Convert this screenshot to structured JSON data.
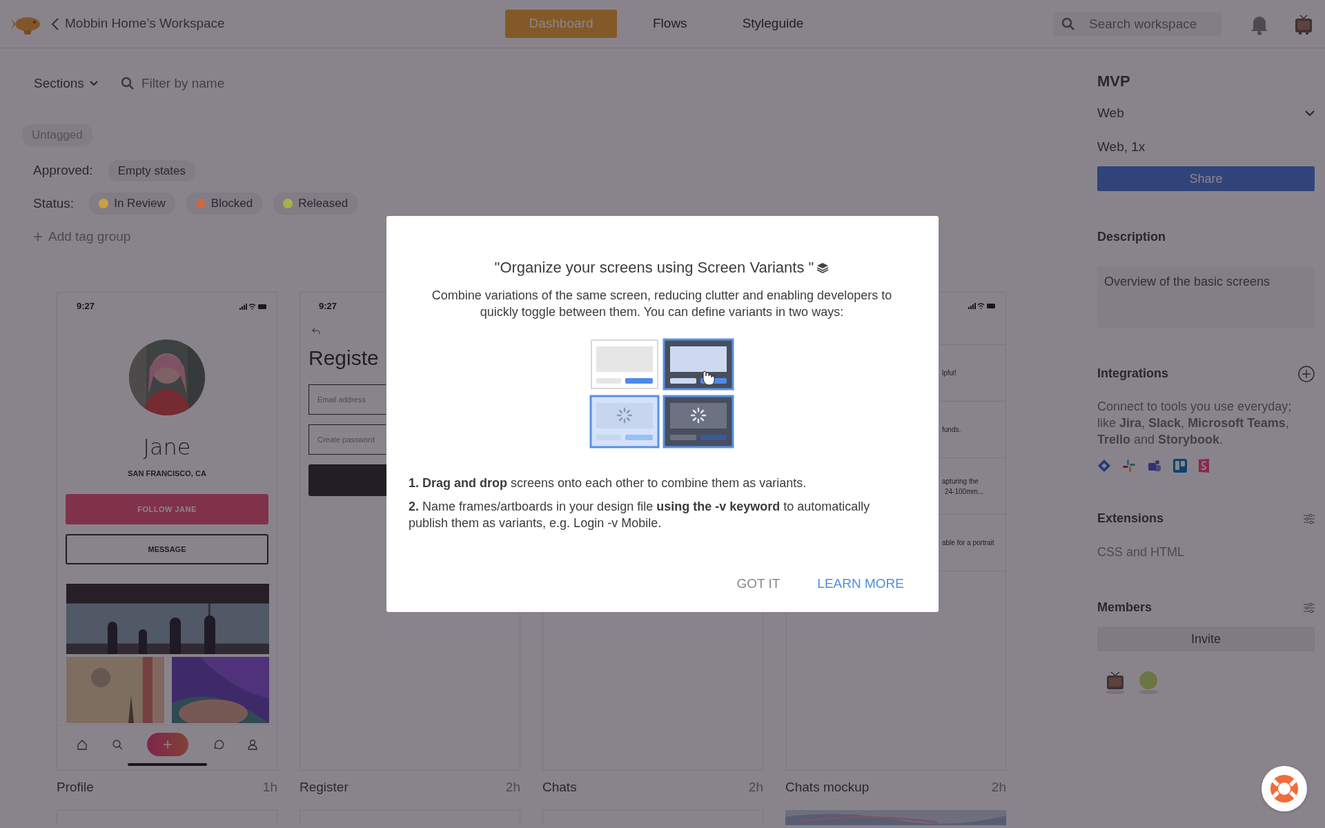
{
  "top_bar": {
    "back_label": "Mobbin Home’s Workspace",
    "tabs": [
      {
        "label": "Dashboard",
        "selected": true
      },
      {
        "label": "Flows",
        "selected": false
      },
      {
        "label": "Styleguide",
        "selected": false
      }
    ],
    "search": {
      "placeholder": "Search workspace"
    }
  },
  "filters": {
    "sections_label": "Sections",
    "filter": {
      "placeholder": "Filter by name"
    },
    "untagged": "Untagged",
    "tag_groups": [
      {
        "label": "Approved:",
        "tags": [
          {
            "label": "Empty states"
          }
        ]
      },
      {
        "label": "Status:",
        "tags": [
          {
            "label": "In Review",
            "color": "#c8a040"
          },
          {
            "label": "Blocked",
            "color": "#c86a48"
          },
          {
            "label": "Released",
            "color": "#a8b048"
          }
        ]
      }
    ],
    "add_tag_group": "Add tag group"
  },
  "screens": [
    {
      "kind": "profile",
      "time": "9:27",
      "name": "Jane",
      "location": "SAN FRANCISCO, CA",
      "follow": "FOLLOW JANE",
      "message": "MESSAGE",
      "title": "Profile",
      "age": "1h"
    },
    {
      "kind": "register",
      "time": "9:27",
      "heading": "Registe",
      "fields": [
        {
          "placeholder": "Email address"
        },
        {
          "placeholder": "Create password"
        }
      ],
      "title": "Register",
      "age": "2h"
    },
    {
      "kind": "blank",
      "title": "Chats",
      "age": "2h"
    },
    {
      "kind": "chat_list",
      "snippets": [
        [
          "lpful!"
        ],
        [
          "funds."
        ],
        [
          "apturing the",
          "24-100mm..."
        ],
        [
          "able for a portrait"
        ]
      ],
      "title": "Chats mockup",
      "age": "2h"
    }
  ],
  "next_row": [
    {
      "kind": "screen"
    },
    {
      "kind": "screen"
    },
    {
      "kind": "screen"
    },
    {
      "kind": "picture"
    }
  ],
  "panel": {
    "title": "MVP",
    "platform": "Web",
    "resolution": "Web, 1x",
    "share": "Share",
    "description": {
      "heading": "Description",
      "text": "Overview of the basic screens"
    },
    "integrations": {
      "heading": "Integrations",
      "text": "Connect to tools you use everyday; like **Jira**, **Slack**, **Microsoft Teams**, **Trello** and **Storybook**."
    },
    "extensions": {
      "heading": "Extensions",
      "text": "CSS and HTML"
    },
    "members": {
      "heading": "Members",
      "invite": "Invite"
    }
  },
  "modal": {
    "title": "\"Organize your screens using Screen Variants \"",
    "body": "Combine variations of the same screen, reducing clutter and enabling developers to quickly toggle between them. You can define variants in two ways:",
    "steps": [
      "**1. Drag and drop** screens onto each other to combine them as variants.",
      "**2.** Name frames/artboards in your design file **using the -v keyword** to automatically publish them as variants, e.g. Login -v Mobile."
    ],
    "buttons": [
      {
        "label": "GOT IT",
        "kind": "plain"
      },
      {
        "label": "LEARN MORE",
        "kind": "primary"
      }
    ]
  }
}
